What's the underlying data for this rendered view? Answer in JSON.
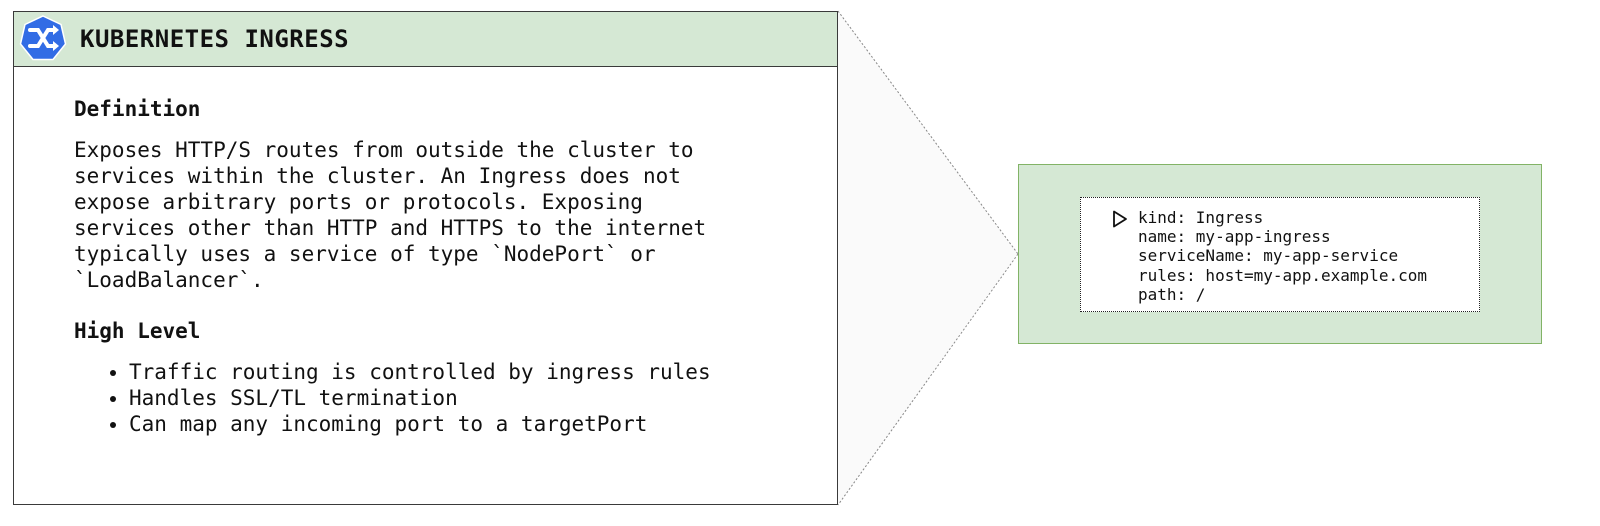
{
  "card": {
    "title": "KUBERNETES INGRESS",
    "logo_icon": "kubernetes-shuffle-icon",
    "accent_color": "#d5e8d4",
    "logo_color": "#326ce5",
    "definition_heading": "Definition",
    "definition_text": "Exposes HTTP/S routes from outside the cluster to\nservices within the cluster. An Ingress does not\nexpose arbitrary ports or protocols. Exposing\nservices other than HTTP and HTTPS to the internet\ntypically uses a service of type `NodePort` or\n`LoadBalancer`.",
    "high_level_heading": "High Level",
    "bullets": [
      "Traffic routing is controlled by ingress rules",
      "Handles SSL/TL termination",
      "Can map any incoming port to a targetPort"
    ]
  },
  "yaml": {
    "icon": "play-icon",
    "lines": [
      "kind: Ingress",
      "name: my-app-ingress",
      "serviceName: my-app-service",
      "rules: host=my-app.example.com",
      "path: /"
    ]
  }
}
